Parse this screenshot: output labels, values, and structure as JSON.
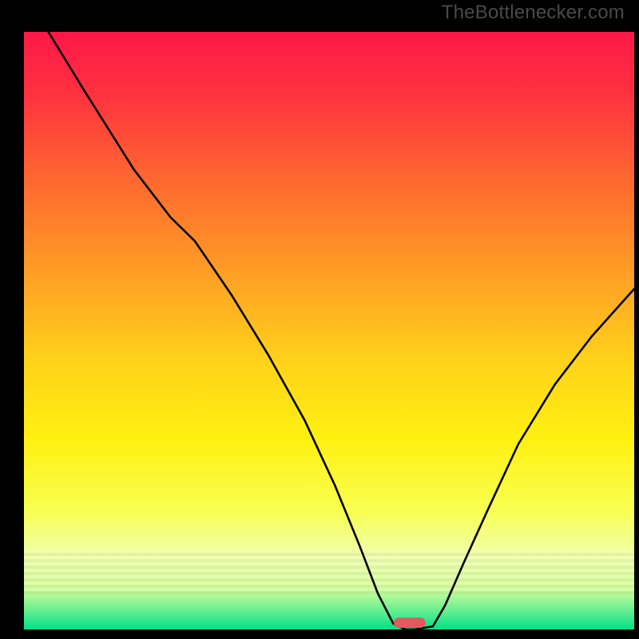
{
  "watermark": "TheBottlenecker.com",
  "chart_data": {
    "type": "line",
    "title": "",
    "xlabel": "",
    "ylabel": "",
    "xlim": [
      0,
      100
    ],
    "ylim": [
      0,
      100
    ],
    "background_gradient": {
      "stops": [
        {
          "offset": 0.0,
          "color": "#ff1848"
        },
        {
          "offset": 0.1,
          "color": "#ff3040"
        },
        {
          "offset": 0.24,
          "color": "#ff6530"
        },
        {
          "offset": 0.4,
          "color": "#ff9d25"
        },
        {
          "offset": 0.55,
          "color": "#ffd21a"
        },
        {
          "offset": 0.68,
          "color": "#fff010"
        },
        {
          "offset": 0.8,
          "color": "#f8ff50"
        },
        {
          "offset": 0.88,
          "color": "#f0ffb0"
        },
        {
          "offset": 0.93,
          "color": "#d8ffa0"
        },
        {
          "offset": 0.965,
          "color": "#70f090"
        },
        {
          "offset": 1.0,
          "color": "#00e088"
        }
      ]
    },
    "curve": {
      "x": [
        4,
        10,
        18,
        24,
        28,
        34,
        40,
        46,
        51,
        55,
        58,
        60.5,
        62.5,
        64,
        67,
        69,
        72,
        76,
        81,
        87,
        93,
        100
      ],
      "y": [
        100,
        90,
        77,
        69,
        65,
        56,
        46,
        35,
        24,
        14,
        6,
        1,
        0,
        0,
        0.5,
        4,
        11,
        20,
        31,
        41,
        49,
        57
      ]
    },
    "marker": {
      "x_center": 63.2,
      "width": 5.2,
      "height": 1.7,
      "color": "#e05a60"
    }
  }
}
